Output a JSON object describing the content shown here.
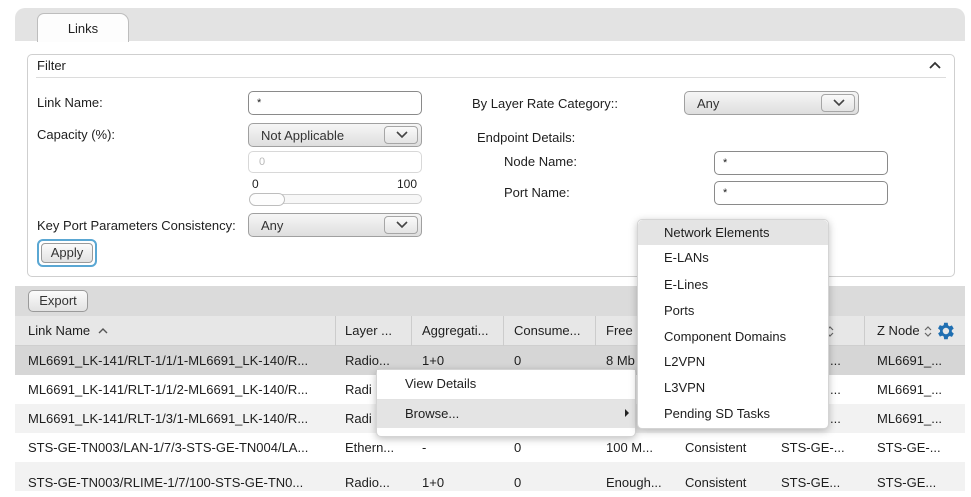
{
  "tabs": {
    "links": "Links"
  },
  "filter": {
    "title": "Filter",
    "link_name_label": "Link Name:",
    "link_name_value": "*",
    "capacity_label": "Capacity (%):",
    "capacity_select": "Not Applicable",
    "capacity_input": "0",
    "slider_min": "0",
    "slider_max": "100",
    "key_port_label": "Key Port Parameters Consistency:",
    "key_port_select": "Any",
    "layer_rate_label": "By Layer Rate Category::",
    "layer_rate_select": "Any",
    "endpoint_label": "Endpoint Details:",
    "node_name_label": "Node Name:",
    "node_name_value": "*",
    "port_name_label": "Port Name:",
    "port_name_value": "*",
    "apply": "Apply"
  },
  "toolbar": {
    "export": "Export"
  },
  "grid": {
    "columns": [
      "Link Name",
      "Layer ...",
      "Aggregati...",
      "Consume...",
      "Free",
      "",
      "",
      "Z Node"
    ],
    "rows": [
      [
        "ML6691_LK-141/RLT-1/1/1-ML6691_LK-140/R...",
        "Radio...",
        "1+0",
        "0",
        "8 Mb",
        "",
        "...",
        "ML6691_..."
      ],
      [
        "ML6691_LK-141/RLT-1/1/2-ML6691_LK-140/R...",
        "Radi",
        "",
        "",
        "",
        "",
        "...",
        "ML6691_..."
      ],
      [
        "ML6691_LK-141/RLT-1/3/1-ML6691_LK-140/R...",
        "Radi",
        "",
        "",
        "",
        "",
        "...",
        "ML6691_..."
      ],
      [
        "STS-GE-TN003/LAN-1/7/3-STS-GE-TN004/LA...",
        "Ethern...",
        "-",
        "0",
        "100 M...",
        "Consistent",
        "STS-GE-...",
        "STS-GE-..."
      ],
      [
        "STS-GE-TN003/RLIME-1/7/100-STS-GE-TN0...",
        "Radio...",
        "1+0",
        "0",
        "Enough...",
        "Consistent",
        "STS-GE...",
        "STS-GE..."
      ]
    ]
  },
  "context_menu": {
    "view_details": "View Details",
    "browse": "Browse..."
  },
  "browse_menu": {
    "items": [
      "Network Elements",
      "E-LANs",
      "E-Lines",
      "Ports",
      "Component Domains",
      "L2VPN",
      "L3VPN",
      "Pending SD Tasks"
    ]
  },
  "colors": {
    "accent": "#1f6fb2",
    "focus": "#5aa7d3",
    "selected_row": "#d6d6d6"
  }
}
